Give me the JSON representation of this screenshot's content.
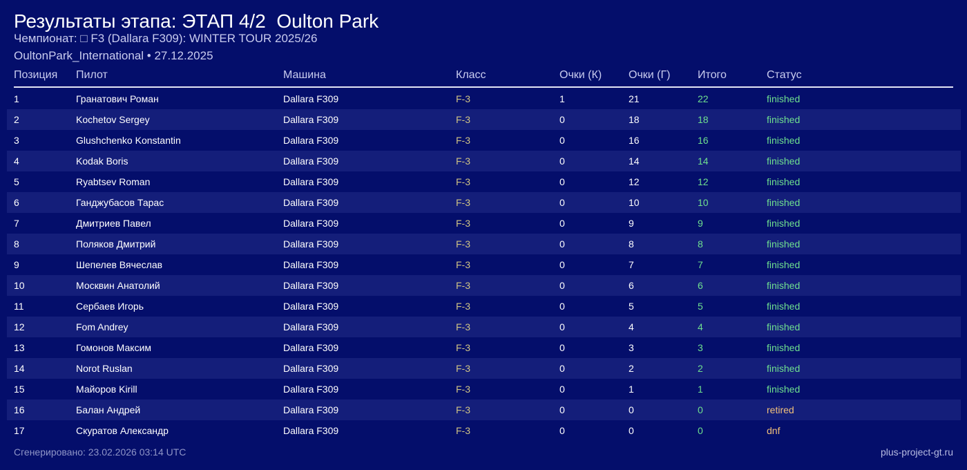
{
  "header": {
    "title": "Результаты этапа: ЭТАП 4/2  Oulton Park",
    "subtitle": "Чемпионат: □ F3 (Dallara F309): WINTER TOUR 2025/26",
    "track_date": "OultonPark_International • 27.12.2025"
  },
  "table": {
    "columns": [
      "Позиция",
      "Пилот",
      "Машина",
      "Класс",
      "Очки (К)",
      "Очки (Г)",
      "Итого",
      "Статус"
    ],
    "rows": [
      {
        "pos": "1",
        "pilot": "Гранатович Роман",
        "car": "Dallara F309",
        "klass": "F-3",
        "pk": "1",
        "pg": "21",
        "total": "22",
        "status": "finished"
      },
      {
        "pos": "2",
        "pilot": "Kochetov Sergey",
        "car": "Dallara F309",
        "klass": "F-3",
        "pk": "0",
        "pg": "18",
        "total": "18",
        "status": "finished"
      },
      {
        "pos": "3",
        "pilot": "Glushchenko Konstantin",
        "car": "Dallara F309",
        "klass": "F-3",
        "pk": "0",
        "pg": "16",
        "total": "16",
        "status": "finished"
      },
      {
        "pos": "4",
        "pilot": "Kodak Boris",
        "car": "Dallara F309",
        "klass": "F-3",
        "pk": "0",
        "pg": "14",
        "total": "14",
        "status": "finished"
      },
      {
        "pos": "5",
        "pilot": "Ryabtsev Roman",
        "car": "Dallara F309",
        "klass": "F-3",
        "pk": "0",
        "pg": "12",
        "total": "12",
        "status": "finished"
      },
      {
        "pos": "6",
        "pilot": "Ганджубасов Тарас",
        "car": "Dallara F309",
        "klass": "F-3",
        "pk": "0",
        "pg": "10",
        "total": "10",
        "status": "finished"
      },
      {
        "pos": "7",
        "pilot": "Дмитриев Павел",
        "car": "Dallara F309",
        "klass": "F-3",
        "pk": "0",
        "pg": "9",
        "total": "9",
        "status": "finished"
      },
      {
        "pos": "8",
        "pilot": "Поляков Дмитрий",
        "car": "Dallara F309",
        "klass": "F-3",
        "pk": "0",
        "pg": "8",
        "total": "8",
        "status": "finished"
      },
      {
        "pos": "9",
        "pilot": "Шепелев Вячеслав",
        "car": "Dallara F309",
        "klass": "F-3",
        "pk": "0",
        "pg": "7",
        "total": "7",
        "status": "finished"
      },
      {
        "pos": "10",
        "pilot": "Москвин Анатолий",
        "car": "Dallara F309",
        "klass": "F-3",
        "pk": "0",
        "pg": "6",
        "total": "6",
        "status": "finished"
      },
      {
        "pos": "11",
        "pilot": "Сербаев Игорь",
        "car": "Dallara F309",
        "klass": "F-3",
        "pk": "0",
        "pg": "5",
        "total": "5",
        "status": "finished"
      },
      {
        "pos": "12",
        "pilot": "Fom Andrey",
        "car": "Dallara F309",
        "klass": "F-3",
        "pk": "0",
        "pg": "4",
        "total": "4",
        "status": "finished"
      },
      {
        "pos": "13",
        "pilot": "Гомонов Максим",
        "car": "Dallara F309",
        "klass": "F-3",
        "pk": "0",
        "pg": "3",
        "total": "3",
        "status": "finished"
      },
      {
        "pos": "14",
        "pilot": "Norot Ruslan",
        "car": "Dallara F309",
        "klass": "F-3",
        "pk": "0",
        "pg": "2",
        "total": "2",
        "status": "finished"
      },
      {
        "pos": "15",
        "pilot": "Майоров Kirill",
        "car": "Dallara F309",
        "klass": "F-3",
        "pk": "0",
        "pg": "1",
        "total": "1",
        "status": "finished"
      },
      {
        "pos": "16",
        "pilot": "Балан Андрей",
        "car": "Dallara F309",
        "klass": "F-3",
        "pk": "0",
        "pg": "0",
        "total": "0",
        "status": "retired"
      },
      {
        "pos": "17",
        "pilot": "Скуратов Александр",
        "car": "Dallara F309",
        "klass": "F-3",
        "pk": "0",
        "pg": "0",
        "total": "0",
        "status": "dnf"
      }
    ]
  },
  "footer": {
    "generated": "Сгенерировано: 23.02.2026 03:14 UTC",
    "site": "plus-project-gt.ru"
  },
  "colors": {
    "background": "#040e6b",
    "row_alt": "#141e7a",
    "class_text": "#cfc384",
    "points_green": "#6fe08f",
    "status_warn": "#f1c07a"
  }
}
